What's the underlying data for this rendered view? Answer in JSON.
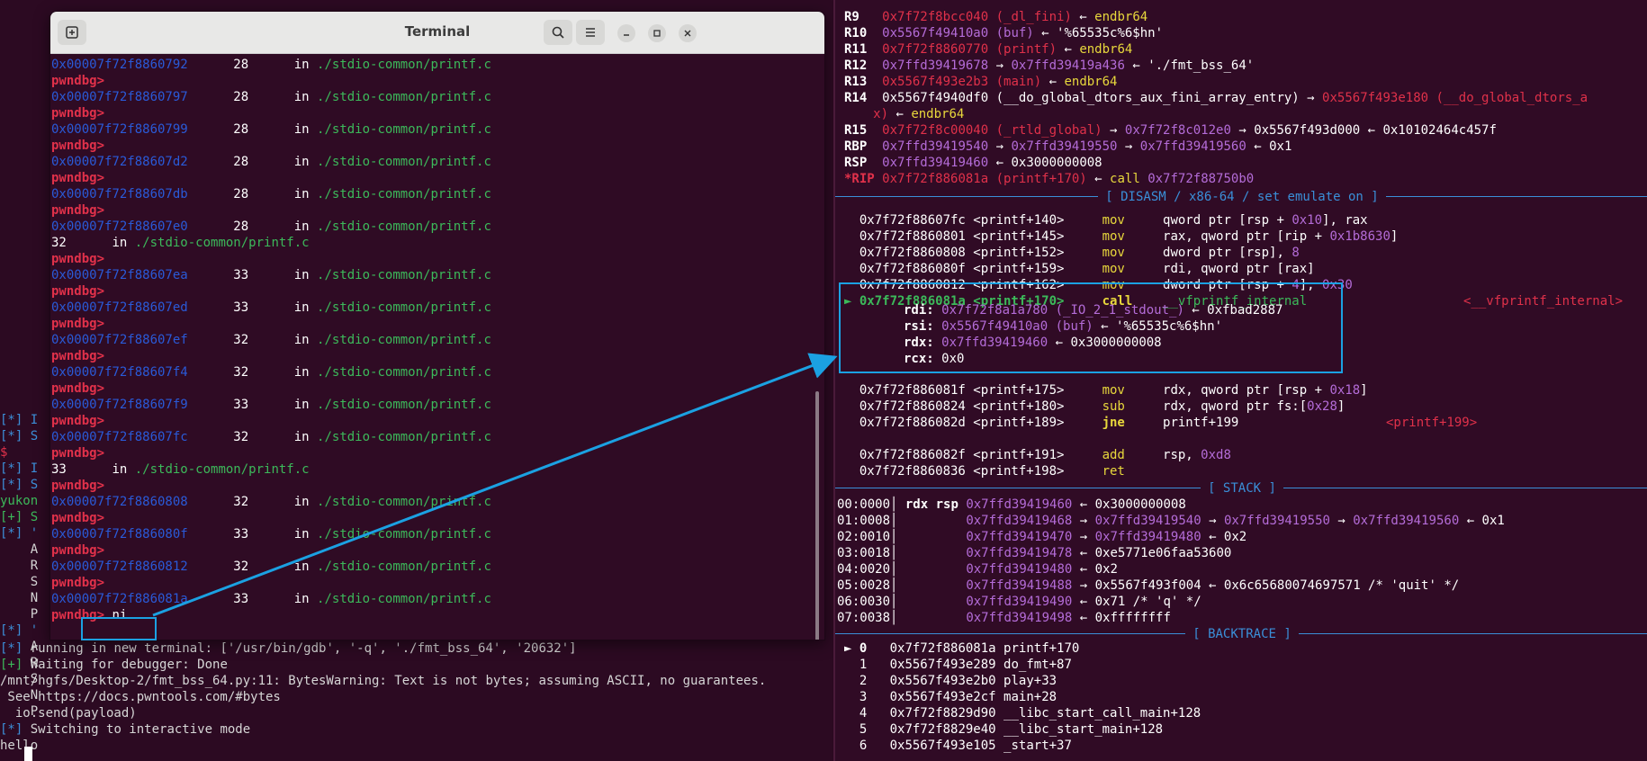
{
  "window": {
    "title": "Terminal"
  },
  "gdb": {
    "prompt": "pwndbg>",
    "lines": [
      {
        "type": "addr",
        "addr": "0x00007f72f8860792",
        "line": "28",
        "in": "in",
        "file": "./stdio-common/printf.c"
      },
      {
        "type": "prompt"
      },
      {
        "type": "addr",
        "addr": "0x00007f72f8860797",
        "line": "28",
        "in": "in",
        "file": "./stdio-common/printf.c"
      },
      {
        "type": "prompt"
      },
      {
        "type": "addr",
        "addr": "0x00007f72f8860799",
        "line": "28",
        "in": "in",
        "file": "./stdio-common/printf.c"
      },
      {
        "type": "prompt"
      },
      {
        "type": "addr",
        "addr": "0x00007f72f88607d2",
        "line": "28",
        "in": "in",
        "file": "./stdio-common/printf.c"
      },
      {
        "type": "prompt"
      },
      {
        "type": "addr",
        "addr": "0x00007f72f88607db",
        "line": "28",
        "in": "in",
        "file": "./stdio-common/printf.c"
      },
      {
        "type": "prompt"
      },
      {
        "type": "addr",
        "addr": "0x00007f72f88607e0",
        "line": "28",
        "in": "in",
        "file": "./stdio-common/printf.c"
      },
      {
        "type": "plain",
        "line": "32",
        "in": "in",
        "file": "./stdio-common/printf.c"
      },
      {
        "type": "prompt"
      },
      {
        "type": "addr",
        "addr": "0x00007f72f88607ea",
        "line": "33",
        "in": "in",
        "file": "./stdio-common/printf.c"
      },
      {
        "type": "prompt"
      },
      {
        "type": "addr",
        "addr": "0x00007f72f88607ed",
        "line": "33",
        "in": "in",
        "file": "./stdio-common/printf.c"
      },
      {
        "type": "prompt"
      },
      {
        "type": "addr",
        "addr": "0x00007f72f88607ef",
        "line": "32",
        "in": "in",
        "file": "./stdio-common/printf.c"
      },
      {
        "type": "prompt"
      },
      {
        "type": "addr",
        "addr": "0x00007f72f88607f4",
        "line": "32",
        "in": "in",
        "file": "./stdio-common/printf.c"
      },
      {
        "type": "prompt"
      },
      {
        "type": "addr",
        "addr": "0x00007f72f88607f9",
        "line": "33",
        "in": "in",
        "file": "./stdio-common/printf.c"
      },
      {
        "type": "prompt"
      },
      {
        "type": "addr",
        "addr": "0x00007f72f88607fc",
        "line": "32",
        "in": "in",
        "file": "./stdio-common/printf.c"
      },
      {
        "type": "prompt"
      },
      {
        "type": "plain",
        "line": "33",
        "in": "in",
        "file": "./stdio-common/printf.c"
      },
      {
        "type": "prompt"
      },
      {
        "type": "addr",
        "addr": "0x00007f72f8860808",
        "line": "32",
        "in": "in",
        "file": "./stdio-common/printf.c"
      },
      {
        "type": "prompt"
      },
      {
        "type": "addr",
        "addr": "0x00007f72f886080f",
        "line": "33",
        "in": "in",
        "file": "./stdio-common/printf.c"
      },
      {
        "type": "prompt"
      },
      {
        "type": "addr",
        "addr": "0x00007f72f8860812",
        "line": "32",
        "in": "in",
        "file": "./stdio-common/printf.c"
      },
      {
        "type": "prompt"
      },
      {
        "type": "addr",
        "addr": "0x00007f72f886081a",
        "line": "33",
        "in": "in",
        "file": "./stdio-common/printf.c"
      },
      {
        "type": "command",
        "cmd": "ni"
      }
    ]
  },
  "left_strip": [
    {
      "text": "[*] I",
      "color": "#3c8fd8"
    },
    {
      "text": "[*] S",
      "color": "#3c8fd8"
    },
    {
      "text": "$",
      "color": "#e0314a"
    },
    {
      "text": "[*] I",
      "color": "#3c8fd8"
    },
    {
      "text": "[*] S",
      "color": "#3c8fd8"
    },
    {
      "text": "yukon",
      "color": "#3cb95a"
    },
    {
      "text": "[+] S",
      "color": "#3cb95a"
    },
    {
      "text": "[*] '",
      "color": "#3c8fd8"
    },
    {
      "text": "    A",
      "color": "#d6d6d6"
    },
    {
      "text": "    R",
      "color": "#d6d6d6"
    },
    {
      "text": "    S",
      "color": "#d6d6d6"
    },
    {
      "text": "    N",
      "color": "#d6d6d6"
    },
    {
      "text": "    P",
      "color": "#d6d6d6"
    },
    {
      "text": "[*] '",
      "color": "#3c8fd8"
    },
    {
      "text": "    A",
      "color": "#d6d6d6"
    },
    {
      "text": "    R",
      "color": "#d6d6d6"
    },
    {
      "text": "    S",
      "color": "#d6d6d6"
    },
    {
      "text": "    N",
      "color": "#d6d6d6"
    },
    {
      "text": "    P",
      "color": "#d6d6d6"
    }
  ],
  "left_bottom": [
    {
      "tag": "[*]",
      "tag_color": "#3c8fd8",
      "text": " running in new terminal: ['/usr/bin/gdb', '-q', './fmt_bss_64', '20632']"
    },
    {
      "tag": "[+]",
      "tag_color": "#3cb95a",
      "text": " Waiting for debugger: Done"
    },
    {
      "tag": "",
      "tag_color": "#d6d6d6",
      "text": "/mnt/hgfs/Desktop-2/fmt_bss_64.py:11: BytesWarning: Text is not bytes; assuming ASCII, no guarantees."
    },
    {
      "tag": "",
      "tag_color": "#d6d6d6",
      "text": " See https://docs.pwntools.com/#bytes"
    },
    {
      "tag": "",
      "tag_color": "#d6d6d6",
      "text": "  io.send(payload)"
    },
    {
      "tag": "[*]",
      "tag_color": "#3c8fd8",
      "text": " Switching to interactive mode"
    },
    {
      "tag": "",
      "tag_color": "#d6d6d6",
      "text": "hello"
    }
  ],
  "registers": [
    {
      "name": "R9",
      "segs": [
        [
          "0x7f72f8bcc040 (_dl_fini)",
          "red"
        ],
        [
          " ← ",
          "white"
        ],
        [
          "endbr64",
          "yellow"
        ]
      ]
    },
    {
      "name": "R10",
      "segs": [
        [
          "0x5567f49410a0 (buf)",
          "purple"
        ],
        [
          " ← '%65535c%6$hn'",
          "white"
        ]
      ]
    },
    {
      "name": "R11",
      "segs": [
        [
          "0x7f72f8860770 (printf)",
          "red"
        ],
        [
          " ← ",
          "white"
        ],
        [
          "endbr64",
          "yellow"
        ]
      ]
    },
    {
      "name": "R12",
      "segs": [
        [
          "0x7ffd39419678",
          "purple"
        ],
        [
          " → ",
          "white"
        ],
        [
          "0x7ffd39419a436",
          "purple"
        ],
        [
          " ← './fmt_bss_64'",
          "white"
        ]
      ]
    },
    {
      "name": "R13",
      "segs": [
        [
          "0x5567f493e2b3 (main)",
          "red"
        ],
        [
          " ← ",
          "white"
        ],
        [
          "endbr64",
          "yellow"
        ]
      ]
    },
    {
      "name": "R14",
      "segs": [
        [
          "0x5567f4940df0 (__do_global_dtors_aux_fini_array_entry)",
          "white"
        ],
        [
          " → ",
          "white"
        ],
        [
          "0x5567f493e180 (__do_global_dtors_a",
          "red"
        ]
      ]
    },
    {
      "name": "",
      "segs": [
        [
          "x)",
          "red"
        ],
        [
          " ← ",
          "white"
        ],
        [
          "endbr64",
          "yellow"
        ]
      ]
    },
    {
      "name": "R15",
      "segs": [
        [
          "0x7f72f8c00040 (_rtld_global)",
          "red"
        ],
        [
          " → ",
          "white"
        ],
        [
          "0x7f72f8c012e0",
          "purple"
        ],
        [
          " → 0x5567f493d000 ← 0x10102464c457f",
          "white"
        ]
      ]
    },
    {
      "name": "RBP",
      "segs": [
        [
          "0x7ffd39419540",
          "purple"
        ],
        [
          " → ",
          "white"
        ],
        [
          "0x7ffd39419550",
          "purple"
        ],
        [
          " → ",
          "white"
        ],
        [
          "0x7ffd39419560",
          "purple"
        ],
        [
          " ← 0x1",
          "white"
        ]
      ]
    },
    {
      "name": "RSP",
      "segs": [
        [
          "0x7ffd39419460",
          "purple"
        ],
        [
          " ← 0x3000000008",
          "white"
        ]
      ]
    },
    {
      "name": "*RIP",
      "segs": [
        [
          "0x7f72f886081a (printf+170)",
          "red"
        ],
        [
          " ← ",
          "white"
        ],
        [
          "call ",
          "yellow"
        ],
        [
          "0x7f72f88750b0",
          "purple"
        ]
      ]
    }
  ],
  "disasm_header": "[ DISASM / x86-64 / set emulate on ]",
  "disasm": [
    {
      "marker": "",
      "addr": "0x7f72f88607fc <printf+140>",
      "mn": "mov",
      "ops": [
        [
          "qword ptr [rsp + ",
          "white"
        ],
        [
          "0x10",
          "purple"
        ],
        [
          "], rax",
          "white"
        ]
      ],
      "ann": ""
    },
    {
      "marker": "",
      "addr": "0x7f72f8860801 <printf+145>",
      "mn": "mov",
      "ops": [
        [
          "rax, qword ptr [rip + ",
          "white"
        ],
        [
          "0x1b8630",
          "purple"
        ],
        [
          "]",
          "white"
        ]
      ],
      "ann": ""
    },
    {
      "marker": "",
      "addr": "0x7f72f8860808 <printf+152>",
      "mn": "mov",
      "ops": [
        [
          "dword ptr [rsp], ",
          "white"
        ],
        [
          "8",
          "purple"
        ]
      ],
      "ann": ""
    },
    {
      "marker": "",
      "addr": "0x7f72f886080f <printf+159>",
      "mn": "mov",
      "ops": [
        [
          "rdi, qword ptr [rax]",
          "white"
        ]
      ],
      "ann": ""
    },
    {
      "marker": "",
      "addr": "0x7f72f8860812 <printf+162>",
      "mn": "mov",
      "ops": [
        [
          "dword ptr [rsp + ",
          "white"
        ],
        [
          "4",
          "purple"
        ],
        [
          "], ",
          "white"
        ],
        [
          "0x30",
          "purple"
        ]
      ],
      "ann": ""
    },
    {
      "marker": "►",
      "addr": "0x7f72f886081a <printf+170>",
      "mn": "call",
      "ops": [
        [
          "__vfprintf_internal",
          "green"
        ]
      ],
      "ann": "<__vfprintf_internal>"
    }
  ],
  "call_args": [
    {
      "reg": "rdi:",
      "segs": [
        [
          "0x7f72f8a1a780 (_IO_2_1_stdout_)",
          "purple"
        ],
        [
          " ← 0xfbad2887",
          "white"
        ]
      ]
    },
    {
      "reg": "rsi:",
      "segs": [
        [
          "0x5567f49410a0 (buf)",
          "purple"
        ],
        [
          " ← '%65535c%6$hn'",
          "white"
        ]
      ]
    },
    {
      "reg": "rdx:",
      "segs": [
        [
          "0x7ffd39419460",
          "purple"
        ],
        [
          " ← 0x3000000008",
          "white"
        ]
      ]
    },
    {
      "reg": "rcx:",
      "segs": [
        [
          "0x0",
          "white"
        ]
      ]
    }
  ],
  "disasm2": [
    {
      "addr": "0x7f72f886081f <printf+175>",
      "mn": "mov",
      "mncolor": "yellow",
      "ops": [
        [
          "rdx, qword ptr [rsp + ",
          "white"
        ],
        [
          "0x18",
          "purple"
        ],
        [
          "]",
          "white"
        ]
      ],
      "ann": ""
    },
    {
      "addr": "0x7f72f8860824 <printf+180>",
      "mn": "sub",
      "mncolor": "yellow",
      "ops": [
        [
          "rdx, qword ptr fs:[",
          "white"
        ],
        [
          "0x28",
          "purple"
        ],
        [
          "]",
          "white"
        ]
      ],
      "ann": ""
    },
    {
      "addr": "0x7f72f886082d <printf+189>",
      "mn": "jne",
      "mncolor": "yellow",
      "ops": [
        [
          "printf+199",
          "white"
        ]
      ],
      "ann": "<printf+199>"
    },
    {
      "addr": "",
      "mn": "",
      "mncolor": "yellow",
      "ops": [],
      "ann": ""
    },
    {
      "addr": "0x7f72f886082f <printf+191>",
      "mn": "add",
      "mncolor": "yellow",
      "ops": [
        [
          "rsp, ",
          "white"
        ],
        [
          "0xd8",
          "purple"
        ]
      ],
      "ann": ""
    },
    {
      "addr": "0x7f72f8860836 <printf+198>",
      "mn": "ret",
      "mncolor": "yellow",
      "ops": [],
      "ann": ""
    }
  ],
  "stack_header": "[ STACK ]",
  "stack": [
    {
      "off": "00:0000",
      "regs": "rdx rsp",
      "segs": [
        [
          "0x7ffd39419460",
          "purple"
        ],
        [
          " ← 0x3000000008",
          "white"
        ]
      ]
    },
    {
      "off": "01:0008",
      "regs": "",
      "segs": [
        [
          "0x7ffd39419468",
          "purple"
        ],
        [
          " → ",
          "white"
        ],
        [
          "0x7ffd39419540",
          "purple"
        ],
        [
          " → ",
          "white"
        ],
        [
          "0x7ffd39419550",
          "purple"
        ],
        [
          " → ",
          "white"
        ],
        [
          "0x7ffd39419560",
          "purple"
        ],
        [
          " ← 0x1",
          "white"
        ]
      ]
    },
    {
      "off": "02:0010",
      "regs": "",
      "segs": [
        [
          "0x7ffd39419470",
          "purple"
        ],
        [
          " → ",
          "white"
        ],
        [
          "0x7ffd39419480",
          "purple"
        ],
        [
          " ← 0x2",
          "white"
        ]
      ]
    },
    {
      "off": "03:0018",
      "regs": "",
      "segs": [
        [
          "0x7ffd39419478",
          "purple"
        ],
        [
          " ← 0xe5771e06faa53600",
          "white"
        ]
      ]
    },
    {
      "off": "04:0020",
      "regs": "",
      "segs": [
        [
          "0x7ffd39419480",
          "purple"
        ],
        [
          " ← 0x2",
          "white"
        ]
      ]
    },
    {
      "off": "05:0028",
      "regs": "",
      "segs": [
        [
          "0x7ffd39419488",
          "purple"
        ],
        [
          " → 0x5567f493f004 ← 0x6c65680074697571 /* 'quit' */",
          "white"
        ]
      ]
    },
    {
      "off": "06:0030",
      "regs": "",
      "segs": [
        [
          "0x7ffd39419490",
          "purple"
        ],
        [
          " ← 0x71 /* 'q' */",
          "white"
        ]
      ]
    },
    {
      "off": "07:0038",
      "regs": "",
      "segs": [
        [
          "0x7ffd39419498",
          "purple"
        ],
        [
          " ← 0xffffffff",
          "white"
        ]
      ]
    }
  ],
  "backtrace_header": "[ BACKTRACE ]",
  "backtrace": [
    {
      "marker": "► 0",
      "addr": "0x7f72f886081a",
      "sym": "printf+170"
    },
    {
      "marker": "  1",
      "addr": "0x5567f493e289",
      "sym": "do_fmt+87"
    },
    {
      "marker": "  2",
      "addr": "0x5567f493e2b0",
      "sym": "play+33"
    },
    {
      "marker": "  3",
      "addr": "0x5567f493e2cf",
      "sym": "main+28"
    },
    {
      "marker": "  4",
      "addr": "0x7f72f8829d90",
      "sym": "__libc_start_call_main+128"
    },
    {
      "marker": "  5",
      "addr": "0x7f72f8829e40",
      "sym": "__libc_start_main+128"
    },
    {
      "marker": "  6",
      "addr": "0x5567f493e105",
      "sym": "_start+37"
    }
  ],
  "colors": {
    "highlight_box": "#1ba1e2",
    "prompt_red": "#e0314a",
    "address_blue": "#2a5ad8",
    "path_green": "#3cb95a"
  }
}
